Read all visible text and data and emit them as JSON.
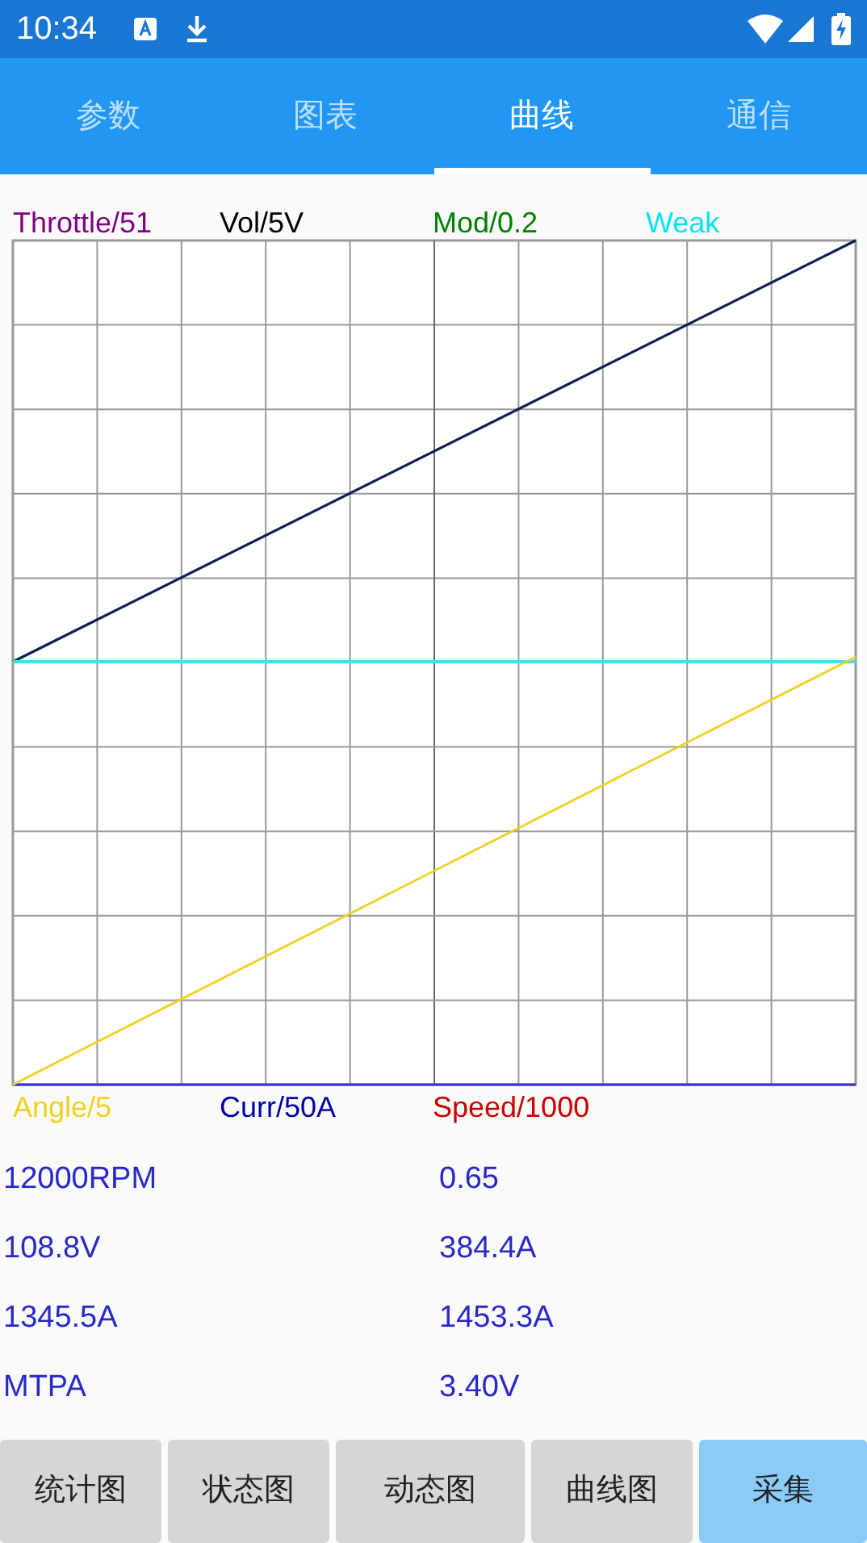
{
  "status_bar": {
    "time": "10:34"
  },
  "tabs": [
    {
      "label": "参数",
      "selected": false
    },
    {
      "label": "图表",
      "selected": false
    },
    {
      "label": "曲线",
      "selected": true
    },
    {
      "label": "通信",
      "selected": false
    }
  ],
  "legend_top": [
    {
      "label": "Throttle/51",
      "color": "#800080"
    },
    {
      "label": "Vol/5V",
      "color": "#000000"
    },
    {
      "label": "Mod/0.2",
      "color": "#008000"
    },
    {
      "label": "Weak",
      "color": "#00e5ee"
    }
  ],
  "legend_bottom": [
    {
      "label": "Angle/5",
      "color": "#f0d020"
    },
    {
      "label": "Curr/50A",
      "color": "#0000aa"
    },
    {
      "label": "Speed/1000",
      "color": "#cc0000"
    }
  ],
  "readings": [
    [
      "12000RPM",
      "0.65"
    ],
    [
      "108.8V",
      "384.4A"
    ],
    [
      "1345.5A",
      "1453.3A"
    ],
    [
      "MTPA",
      "3.40V"
    ]
  ],
  "buttons": [
    {
      "label": "统计图",
      "selected": false
    },
    {
      "label": "状态图",
      "selected": false
    },
    {
      "label": "动态图",
      "selected": false
    },
    {
      "label": "曲线图",
      "selected": false
    },
    {
      "label": "采集",
      "selected": true
    }
  ]
}
